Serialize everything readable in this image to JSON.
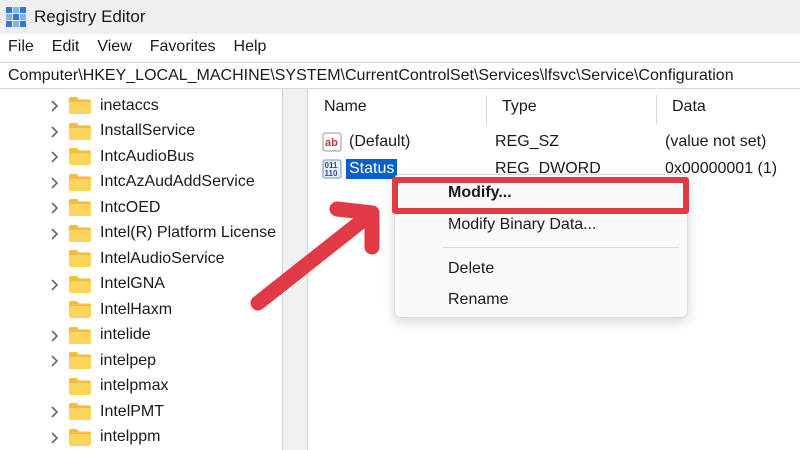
{
  "window": {
    "title": "Registry Editor",
    "app_icon": "registry-icon"
  },
  "menu": [
    "File",
    "Edit",
    "View",
    "Favorites",
    "Help"
  ],
  "address": "Computer\\HKEY_LOCAL_MACHINE\\SYSTEM\\CurrentControlSet\\Services\\lfsvc\\Service\\Configuration",
  "tree": {
    "items": [
      {
        "label": "inetaccs",
        "expandable": true
      },
      {
        "label": "InstallService",
        "expandable": true
      },
      {
        "label": "IntcAudioBus",
        "expandable": true
      },
      {
        "label": "IntcAzAudAddService",
        "expandable": true
      },
      {
        "label": "IntcOED",
        "expandable": true
      },
      {
        "label": "Intel(R) Platform License",
        "expandable": true
      },
      {
        "label": "IntelAudioService",
        "expandable": false
      },
      {
        "label": "IntelGNA",
        "expandable": true
      },
      {
        "label": "IntelHaxm",
        "expandable": false
      },
      {
        "label": "intelide",
        "expandable": true
      },
      {
        "label": "intelpep",
        "expandable": true
      },
      {
        "label": "intelpmax",
        "expandable": false
      },
      {
        "label": "IntelPMT",
        "expandable": true
      },
      {
        "label": "intelppm",
        "expandable": true
      }
    ]
  },
  "list": {
    "columns": {
      "name": "Name",
      "type": "Type",
      "data": "Data"
    },
    "rows": [
      {
        "name": "(Default)",
        "type": "REG_SZ",
        "data": "(value not set)",
        "icon": "string-value-icon",
        "selected": false
      },
      {
        "name": "Status",
        "type": "REG_DWORD",
        "data": "0x00000001 (1)",
        "icon": "binary-value-icon",
        "selected": true
      }
    ]
  },
  "context_menu": {
    "modify": "Modify...",
    "modify_binary": "Modify Binary Data...",
    "delete": "Delete",
    "rename": "Rename"
  },
  "annotation": {
    "color": "#e03a46"
  }
}
